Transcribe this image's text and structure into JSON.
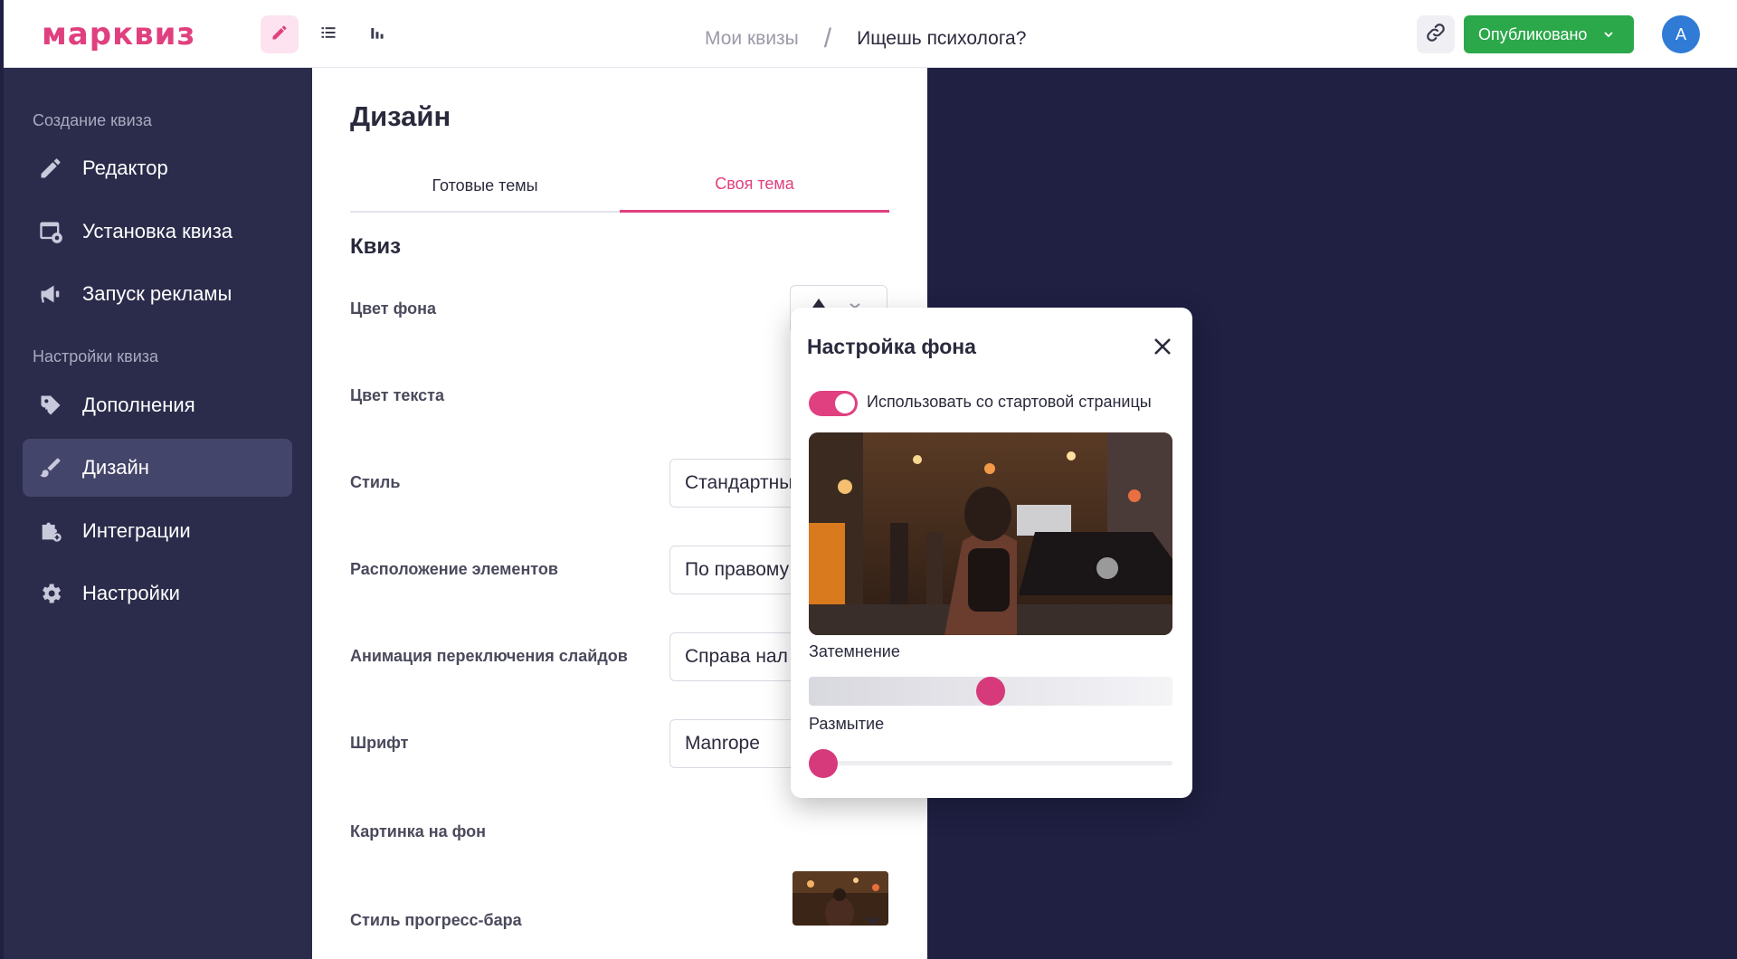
{
  "header": {
    "logo": "марквиз",
    "breadcrumb_root": "Мои квизы",
    "breadcrumb_sep": "/",
    "breadcrumb_current": "Ищешь психолога?",
    "publish_label": "Опубликовано",
    "avatar_letter": "A"
  },
  "sidebar": {
    "section_create": "Создание квиза",
    "section_settings": "Настройки квиза",
    "items": [
      {
        "label": "Редактор",
        "icon": "pencil-icon"
      },
      {
        "label": "Установка квиза",
        "icon": "install-icon"
      },
      {
        "label": "Запуск рекламы",
        "icon": "megaphone-icon"
      },
      {
        "label": "Дополнения",
        "icon": "tag-plus-icon"
      },
      {
        "label": "Дизайн",
        "icon": "brush-icon"
      },
      {
        "label": "Интеграции",
        "icon": "plugin-icon"
      },
      {
        "label": "Настройки",
        "icon": "gear-icon"
      }
    ]
  },
  "design": {
    "title": "Дизайн",
    "tab_ready": "Готовые темы",
    "tab_custom": "Своя тема",
    "section": "Квиз",
    "bg_color_label": "Цвет фона",
    "text_color_label": "Цвет текста",
    "style_label": "Стиль",
    "style_value": "Стандартны",
    "layout_label": "Расположение элементов",
    "layout_value": "По правому",
    "animation_label": "Анимация переключения слайдов",
    "animation_value": "Справа нал",
    "font_label": "Шрифт",
    "font_value": "Manrope",
    "bg_image_label": "Картинка на фон",
    "progress_label": "Стиль прогресс-бара"
  },
  "popover": {
    "title": "Настройка фона",
    "toggle_label": "Использовать со стартовой страницы",
    "toggle_on": true,
    "dim_label": "Затемнение",
    "dim_value": 0.5,
    "blur_label": "Размытие",
    "blur_value": 0
  },
  "colors": {
    "brand": "#e0407f",
    "publish": "#2ba84a",
    "sidebar": "#2b2c4b",
    "canvas": "#1f2042"
  }
}
